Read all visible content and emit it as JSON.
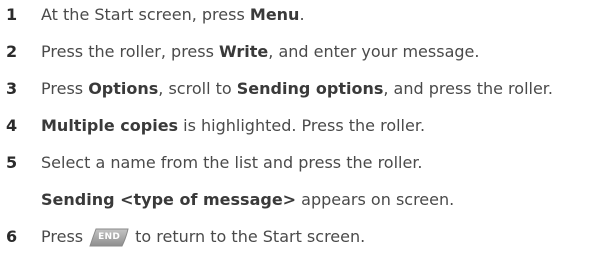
{
  "steps": [
    {
      "num": "1",
      "t1": "At the Start screen, press ",
      "b1": "Menu",
      "t2": "."
    },
    {
      "num": "2",
      "t1": "Press the roller, press ",
      "b1": "Write",
      "t2": ", and enter your message."
    },
    {
      "num": "3",
      "t1": "Press ",
      "b1": "Options",
      "t2": ", scroll to ",
      "b2": "Sending options",
      "t3": ", and press the roller."
    },
    {
      "num": "4",
      "b1": "Multiple copies",
      "t1": " is highlighted. Press the roller."
    },
    {
      "num": "5",
      "t1": "Select a name from the list and press the roller."
    },
    {
      "num": "",
      "b1": "Sending <type of message>",
      "t1": " appears on screen."
    },
    {
      "num": "6",
      "t1": "Press",
      "key": "END",
      "t2": "to return to the Start screen."
    }
  ]
}
